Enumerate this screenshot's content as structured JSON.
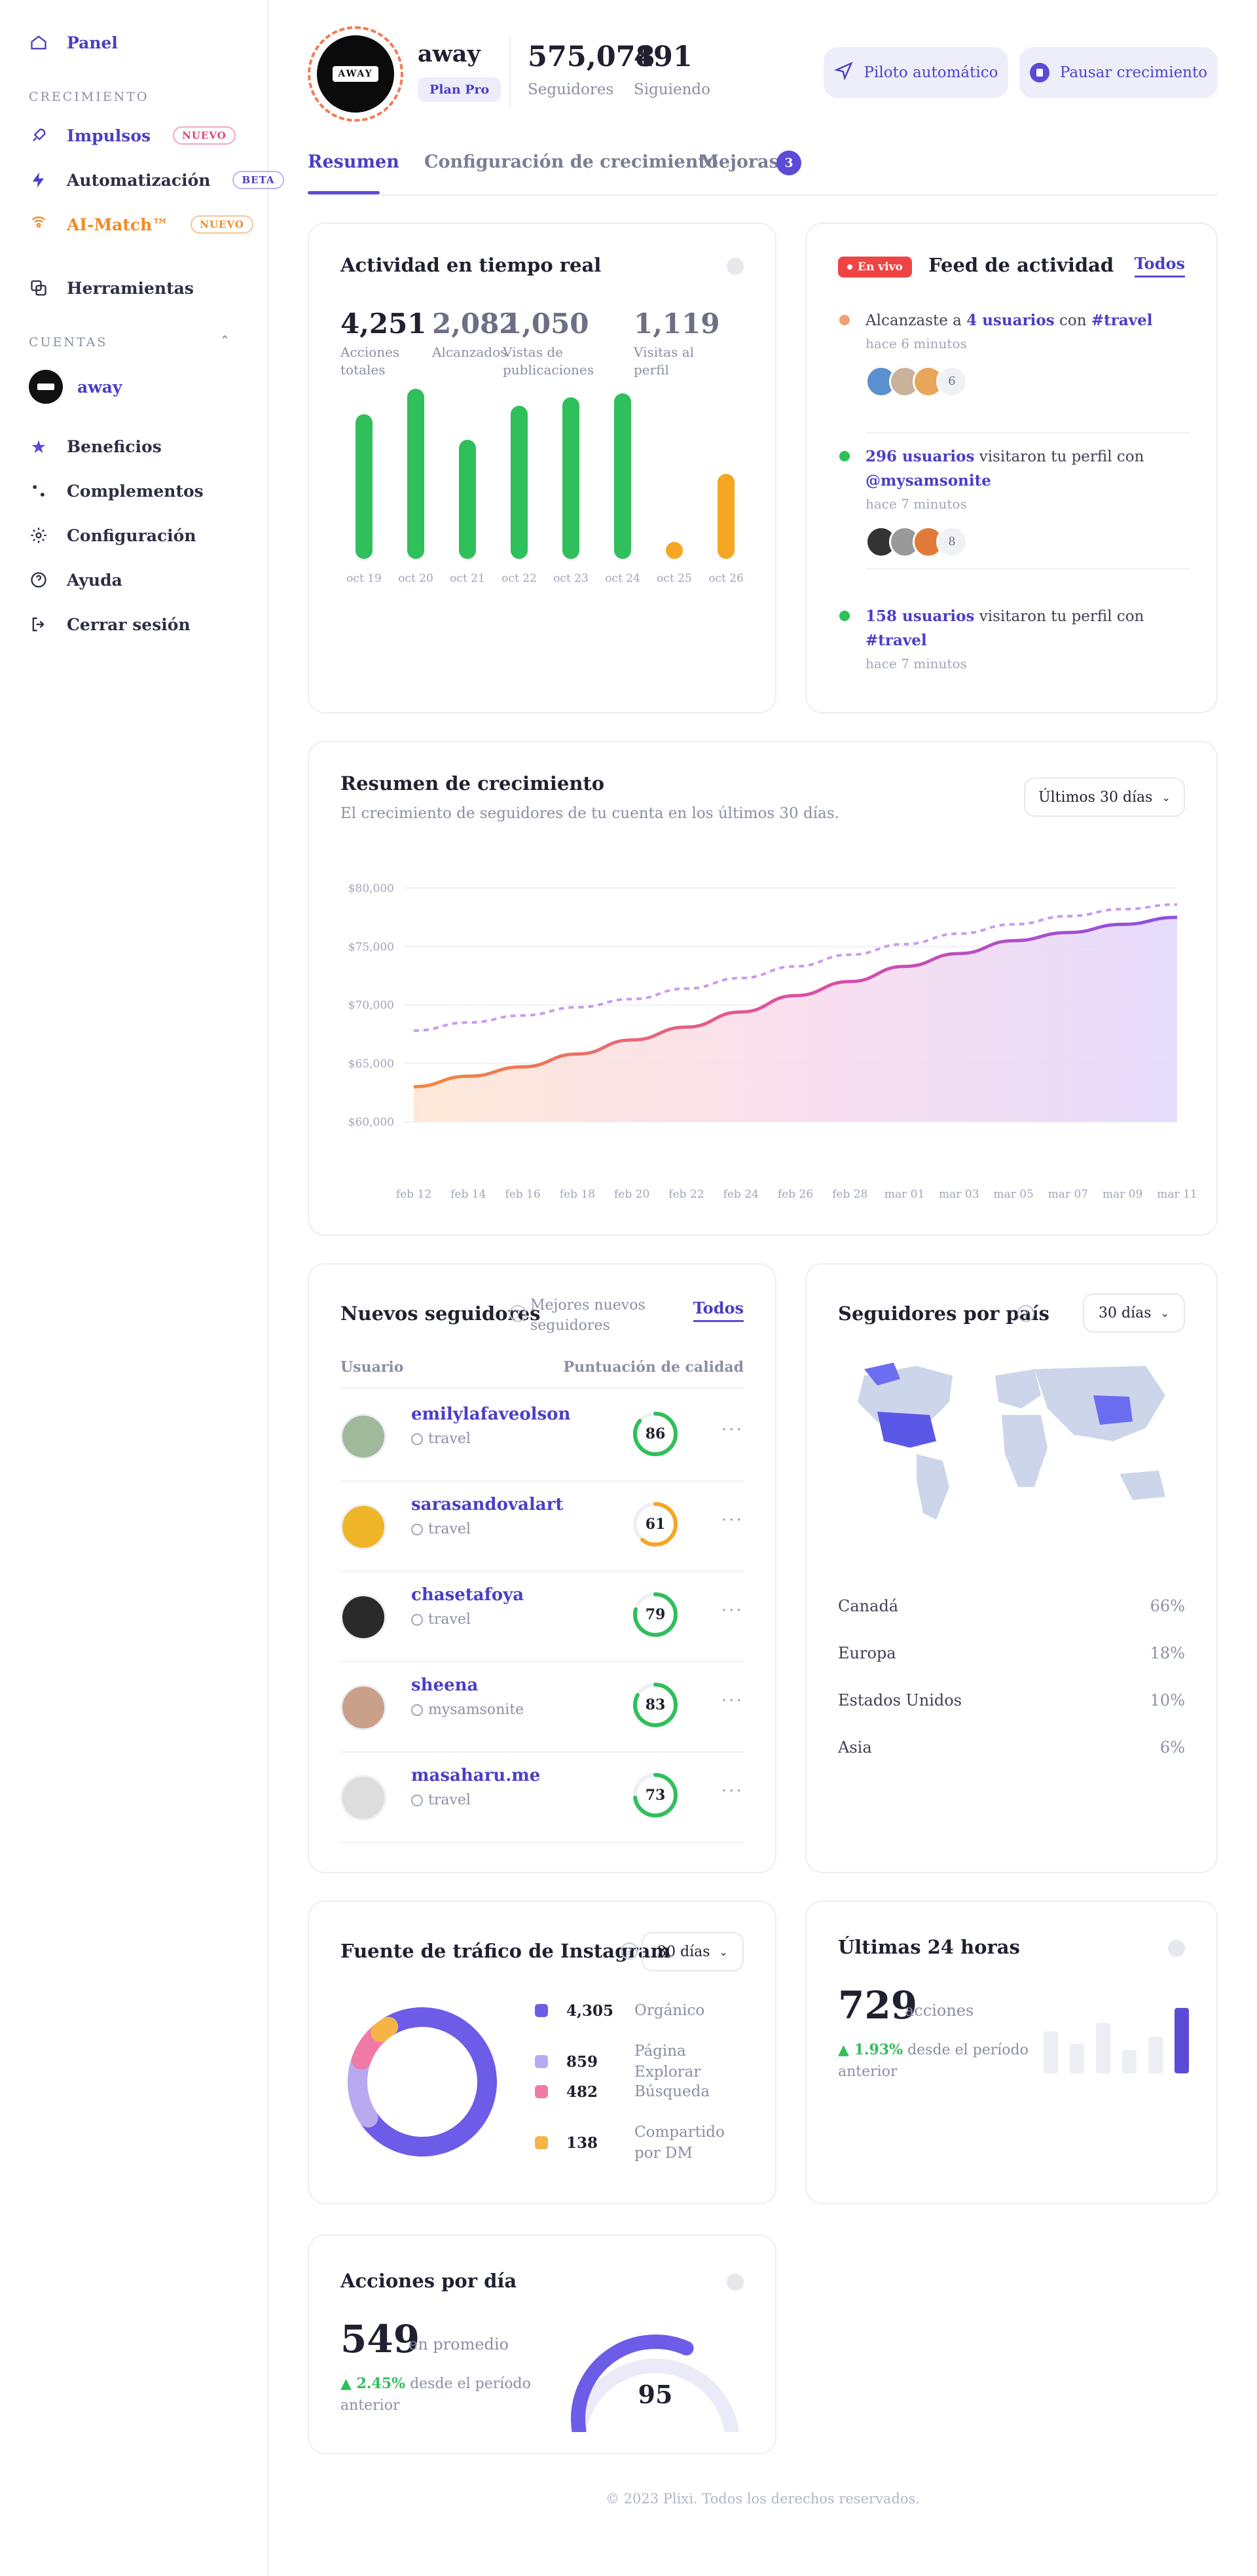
{
  "sidebar": {
    "panel": "Panel",
    "sec_growth": "CRECIMIENTO",
    "impulsos": "Impulsos",
    "impulsos_badge": "NUEVO",
    "automatizacion": "Automatización",
    "automatizacion_badge": "BETA",
    "aimatch": "AI-Match™",
    "aimatch_badge": "NUEVO",
    "herramientas": "Herramientas",
    "sec_accounts": "CUENTAS",
    "account": "away",
    "beneficios": "Beneficios",
    "complementos": "Complementos",
    "configuracion": "Configuración",
    "ayuda": "Ayuda",
    "logout": "Cerrar sesión"
  },
  "profile": {
    "name": "away",
    "logo_text": "AWAY",
    "plan": "Plan Pro",
    "followers": "575,078",
    "followers_label": "Seguidores",
    "following": "491",
    "following_label": "Siguiendo"
  },
  "actions": {
    "autopilot": "Piloto automático",
    "pause": "Pausar crecimiento"
  },
  "tabs": {
    "resumen": "Resumen",
    "config": "Configuración de crecimiento",
    "mejoras": "Mejoras",
    "mejoras_count": "3"
  },
  "realtime": {
    "title": "Actividad en tiempo real",
    "stats": [
      {
        "value": "4,251",
        "label": "Acciones totales"
      },
      {
        "value": "2,082",
        "label": "Alcanzados"
      },
      {
        "value": "1,050",
        "label": "Vistas de publicaciones"
      },
      {
        "value": "1,119",
        "label": "Visitas al perfil"
      }
    ],
    "bars": [
      {
        "label": "oct 19",
        "value": 0.68,
        "color": "#2fbf5b"
      },
      {
        "label": "oct 20",
        "value": 0.8,
        "color": "#2fbf5b"
      },
      {
        "label": "oct 21",
        "value": 0.56,
        "color": "#2fbf5b"
      },
      {
        "label": "oct 22",
        "value": 0.72,
        "color": "#2fbf5b"
      },
      {
        "label": "oct 23",
        "value": 0.76,
        "color": "#2fbf5b"
      },
      {
        "label": "oct 24",
        "value": 0.78,
        "color": "#2fbf5b"
      },
      {
        "label": "oct 25",
        "value": 0.0,
        "color": "#f5a623"
      },
      {
        "label": "oct 26",
        "value": 0.4,
        "color": "#f5a623"
      }
    ]
  },
  "feed": {
    "live": "En vivo",
    "title": "Feed de actividad",
    "all": "Todos",
    "items": [
      {
        "pre": "Alcanzaste a ",
        "link1": "4 usuarios",
        "mid": " con ",
        "link2": "#travel",
        "time": "hace 6 minutos",
        "extra": "6",
        "color": "#f0a070"
      },
      {
        "pre": "",
        "link1": "296 usuarios",
        "mid": " visitaron tu perfil con ",
        "link2": "@mysamsonite",
        "time": "hace 7 minutos",
        "extra": "8",
        "color": "#2fbf5b"
      },
      {
        "pre": "",
        "link1": "158 usuarios",
        "mid": " visitaron tu perfil con ",
        "link2": "#travel",
        "time": "hace 7 minutos",
        "extra": "",
        "color": "#2fbf5b"
      }
    ]
  },
  "growth": {
    "title": "Resumen de crecimiento",
    "subtitle": "El crecimiento de seguidores de tu cuenta en los últimos 30 días.",
    "range": "Últimos 30 días"
  },
  "chart_data": {
    "type": "area",
    "x": [
      "feb 12",
      "feb 14",
      "feb 16",
      "feb 18",
      "feb 20",
      "feb 22",
      "feb 24",
      "feb 26",
      "feb 28",
      "mar 01",
      "mar 03",
      "mar 05",
      "mar 07",
      "mar 09",
      "mar 11"
    ],
    "series": [
      {
        "values": [
          563000,
          563900,
          564700,
          565800,
          567000,
          568100,
          569400,
          570800,
          572000,
          573300,
          574400,
          575500,
          576200,
          576900,
          577500
        ]
      },
      {
        "values": [
          567800,
          568500,
          569100,
          569800,
          570500,
          571400,
          572300,
          573300,
          574300,
          575200,
          576100,
          576900,
          577600,
          578200,
          578600
        ]
      }
    ],
    "yticks": [
      "$60,000",
      "$65,000",
      "$70,000",
      "$75,000",
      "$80,000"
    ],
    "ylim": [
      560000,
      580000
    ]
  },
  "newfollowers": {
    "title": "Nuevos seguidores",
    "best": "Mejores nuevos seguidores",
    "all": "Todos",
    "col_user": "Usuario",
    "col_score": "Puntuación de calidad",
    "rows": [
      {
        "name": "emilylafaveolson",
        "source": "travel",
        "score": 86,
        "color": "#2fbf5b"
      },
      {
        "name": "sarasandovalart",
        "source": "travel",
        "score": 61,
        "color": "#f5a623"
      },
      {
        "name": "chasetafoya",
        "source": "travel",
        "score": 79,
        "color": "#2fbf5b"
      },
      {
        "name": "sheena",
        "source": "mysamsonite",
        "score": 83,
        "color": "#2fbf5b"
      },
      {
        "name": "masaharu.me",
        "source": "travel",
        "score": 73,
        "color": "#2fbf5b"
      }
    ]
  },
  "countries": {
    "title": "Seguidores por país",
    "range": "30 días",
    "rows": [
      {
        "name": "Canadá",
        "pct": "66%"
      },
      {
        "name": "Europa",
        "pct": "18%"
      },
      {
        "name": "Estados Unidos",
        "pct": "10%"
      },
      {
        "name": "Asia",
        "pct": "6%"
      }
    ]
  },
  "traffic": {
    "title": "Fuente de tráfico de Instagram",
    "range": "30 días",
    "items": [
      {
        "value": "4,305",
        "label": "Orgánico",
        "color": "#6c5ce7",
        "n": 4305
      },
      {
        "value": "859",
        "label": "Página Explorar",
        "color": "#b8a9f0",
        "n": 859
      },
      {
        "value": "482",
        "label": "Búsqueda",
        "color": "#ef7aa5",
        "n": 482
      },
      {
        "value": "138",
        "label": "Compartido por DM",
        "color": "#f5b546",
        "n": 138
      }
    ]
  },
  "last24": {
    "title": "Últimas 24 horas",
    "value": "729",
    "unit": "acciones",
    "change": "▲ 1.93%",
    "change_text": "desde el período anterior",
    "bars": [
      0.5,
      0.35,
      0.6,
      0.28,
      0.44,
      0.78
    ]
  },
  "perday": {
    "title": "Acciones por día",
    "value": "549",
    "unit": "en promedio",
    "change": "▲ 2.45%",
    "change_text": "desde el período anterior",
    "gauge": "95",
    "gauge_fraction": 0.62
  },
  "footer": "© 2023 Plixi. Todos los derechos reservados."
}
